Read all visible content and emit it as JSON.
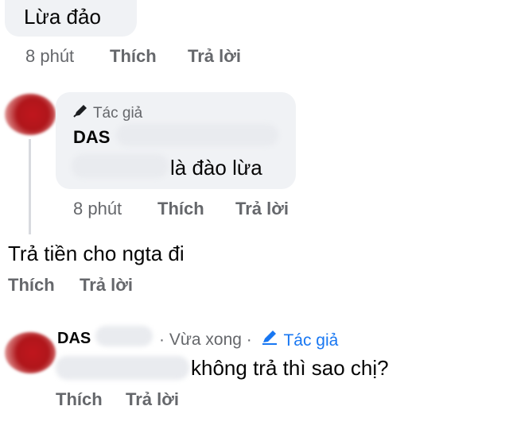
{
  "comment_top": {
    "text": "Lừa đảo",
    "time": "8 phút",
    "like": "Thích",
    "reply": "Trả lời"
  },
  "reply_1": {
    "badge": "Tác giả",
    "name": "DAS",
    "text": "là đào lừa",
    "time": "8 phút",
    "like": "Thích",
    "reply": "Trả lời"
  },
  "comment_2": {
    "text": "Trả tiền cho ngta đi",
    "like": "Thích",
    "reply": "Trả lời"
  },
  "reply_2": {
    "name": "DAS",
    "time": "· Vừa xong ·",
    "badge": "Tác giả",
    "text": "không trả thì sao chị?",
    "like": "Thích",
    "reply": "Trả lời"
  },
  "colors": {
    "bubble": "#f0f2f5",
    "meta": "#65676b",
    "accent": "#1877f2",
    "avatar": "#c0161d"
  },
  "icons": {
    "author_badge": "pen-icon"
  }
}
